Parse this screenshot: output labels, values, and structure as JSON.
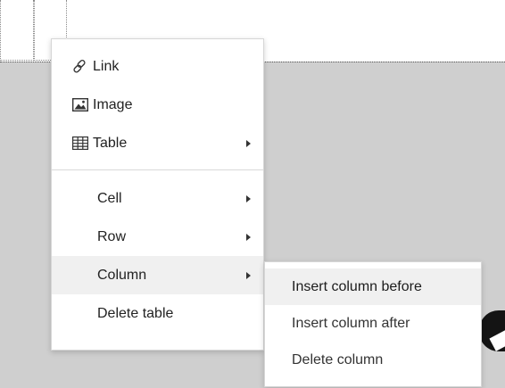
{
  "context_menu": {
    "items": [
      {
        "label": "Link",
        "icon": "link-icon",
        "has_submenu": false
      },
      {
        "label": "Image",
        "icon": "image-icon",
        "has_submenu": false
      },
      {
        "label": "Table",
        "icon": "table-icon",
        "has_submenu": true
      }
    ],
    "table_items": [
      {
        "label": "Cell",
        "has_submenu": true
      },
      {
        "label": "Row",
        "has_submenu": true
      },
      {
        "label": "Column",
        "has_submenu": true,
        "active": true
      },
      {
        "label": "Delete table",
        "has_submenu": false
      }
    ]
  },
  "column_submenu": {
    "items": [
      {
        "label": "Insert column before",
        "active": true
      },
      {
        "label": "Insert column after"
      },
      {
        "label": "Delete column"
      }
    ]
  },
  "colors": {
    "editor_background": "#cfcfcf",
    "menu_background": "#ffffff",
    "hover_background": "#f0f0f0",
    "text": "#222222"
  }
}
